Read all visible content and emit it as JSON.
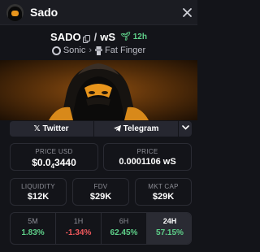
{
  "header": {
    "title": "Sado"
  },
  "pair": {
    "base": "SADO",
    "quote": "wS",
    "age": "12h"
  },
  "chain": {
    "name": "Sonic",
    "dex": "Fat Finger"
  },
  "social": {
    "twitter": "Twitter",
    "telegram": "Telegram"
  },
  "price_usd": {
    "label": "PRICE USD",
    "prefix": "$0.0",
    "zeros": "4",
    "suffix": "3440"
  },
  "price_native": {
    "label": "PRICE",
    "value": "0.0001106 wS"
  },
  "liquidity": {
    "label": "LIQUIDITY",
    "value": "$12K"
  },
  "fdv": {
    "label": "FDV",
    "value": "$29K"
  },
  "mkt_cap": {
    "label": "MKT CAP",
    "value": "$29K"
  },
  "timeframes": [
    {
      "label": "5M",
      "value": "1.83%"
    },
    {
      "label": "1H",
      "value": "-1.34%"
    },
    {
      "label": "6H",
      "value": "62.45%"
    },
    {
      "label": "24H",
      "value": "57.15%"
    }
  ],
  "colors": {
    "positive": "#5fd18a",
    "negative": "#f0585c",
    "accent": "#e8951c"
  }
}
